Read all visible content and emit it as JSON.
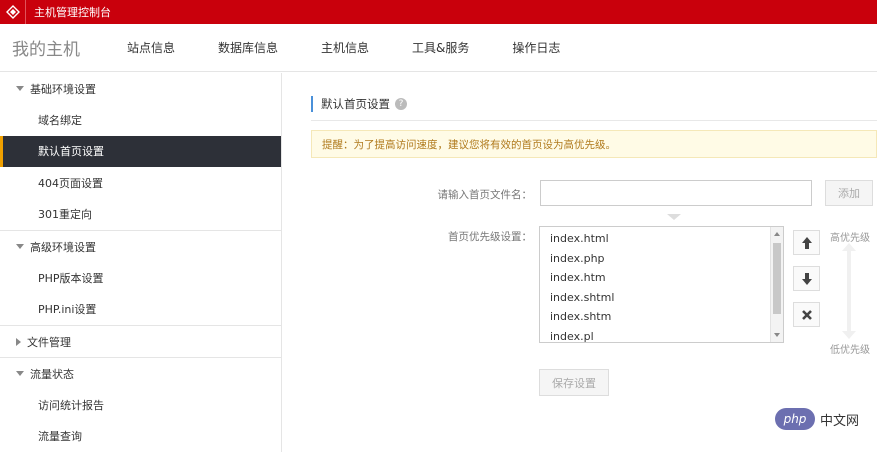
{
  "topbar": {
    "title": "主机管理控制台",
    "logo_icon": "diamond-logo-icon",
    "color": "#c9000c"
  },
  "mainnav": {
    "brand": "我的主机",
    "items": [
      {
        "label": "站点信息"
      },
      {
        "label": "数据库信息"
      },
      {
        "label": "主机信息"
      },
      {
        "label": "工具&服务"
      },
      {
        "label": "操作日志"
      }
    ]
  },
  "sidebar": {
    "groups": [
      {
        "label": "基础环境设置",
        "items": [
          "域名绑定",
          "默认首页设置",
          "404页面设置",
          "301重定向"
        ]
      },
      {
        "label": "高级环境设置",
        "items": [
          "PHP版本设置",
          "PHP.ini设置"
        ]
      },
      {
        "label": "文件管理",
        "items": []
      },
      {
        "label": "流量状态",
        "items": [
          "访问统计报告",
          "流量查询"
        ]
      }
    ],
    "active_item": "默认首页设置"
  },
  "content": {
    "section_title": "默认首页设置",
    "notice": "提醒：为了提高访问速度，建议您将有效的首页设为高优先级。",
    "filename_label": "请输入首页文件名：",
    "filename_value": "",
    "add_button": "添加",
    "priority_label": "首页优先级设置：",
    "files": [
      "index.html",
      "index.php",
      "index.htm",
      "index.shtml",
      "index.shtm",
      "index.pl"
    ],
    "high_priority": "高优先级",
    "low_priority": "低优先级",
    "save_button": "保存设置"
  },
  "watermark": {
    "badge": "php",
    "text": "中文网"
  }
}
